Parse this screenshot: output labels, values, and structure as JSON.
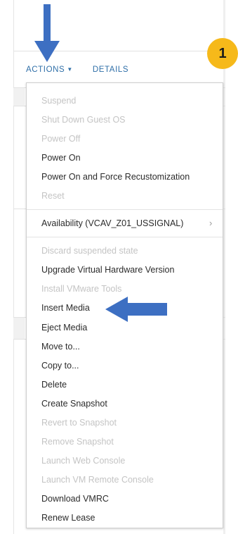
{
  "header": {
    "actions_label": "ACTIONS",
    "details_label": "DETAILS"
  },
  "menu": {
    "items": [
      {
        "label": "Suspend",
        "enabled": false
      },
      {
        "label": "Shut Down Guest OS",
        "enabled": false
      },
      {
        "label": "Power Off",
        "enabled": false
      },
      {
        "label": "Power On",
        "enabled": true
      },
      {
        "label": "Power On and Force Recustomization",
        "enabled": true
      },
      {
        "label": "Reset",
        "enabled": false
      },
      {
        "label": "Availability (VCAV_Z01_USSIGNAL)",
        "enabled": true
      },
      {
        "label": "Discard suspended state",
        "enabled": false
      },
      {
        "label": "Upgrade Virtual Hardware Version",
        "enabled": true
      },
      {
        "label": "Install VMware Tools",
        "enabled": false
      },
      {
        "label": "Insert Media",
        "enabled": true
      },
      {
        "label": "Eject Media",
        "enabled": true
      },
      {
        "label": "Move to...",
        "enabled": true
      },
      {
        "label": "Copy to...",
        "enabled": true
      },
      {
        "label": "Delete",
        "enabled": true
      },
      {
        "label": "Create Snapshot",
        "enabled": true
      },
      {
        "label": "Revert to Snapshot",
        "enabled": false
      },
      {
        "label": "Remove Snapshot",
        "enabled": false
      },
      {
        "label": "Launch Web Console",
        "enabled": false
      },
      {
        "label": "Launch VM Remote Console",
        "enabled": false
      },
      {
        "label": "Download VMRC",
        "enabled": true
      },
      {
        "label": "Renew Lease",
        "enabled": true
      }
    ]
  },
  "annotation": {
    "step_number": "1"
  },
  "colors": {
    "link_blue": "#2f6fa8",
    "arrow_blue": "#3d6fc2",
    "badge_yellow": "#f6b91a",
    "disabled_text": "#c4c4c4"
  }
}
